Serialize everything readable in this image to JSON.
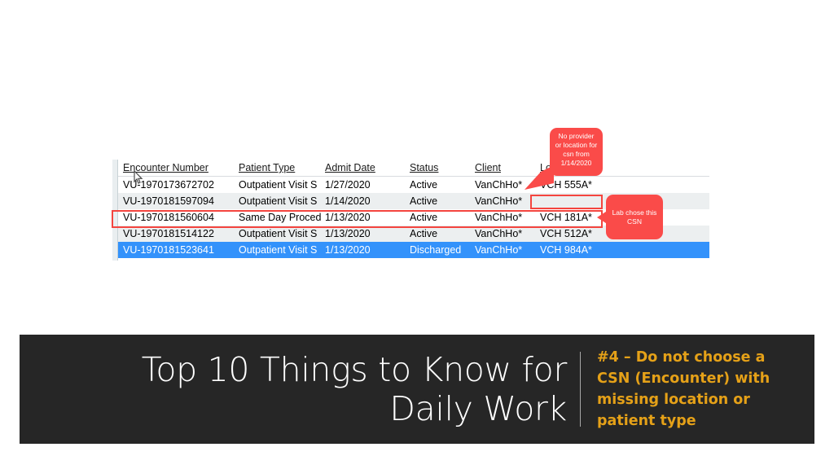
{
  "slide": {
    "background_color": "#ffffff",
    "title_bar": {
      "background_color": "#262626",
      "title": "Top 10 Things to Know for Daily Work",
      "title_color": "#ffffff",
      "subtitle": "#4 – Do not choose a CSN (Encounter) with missing location or patient type",
      "subtitle_color": "#e5a118"
    }
  },
  "screenshot": {
    "app_type": "encounter-grid",
    "colors": {
      "selected_row": "#3392fb",
      "alt_row": "#eceff0",
      "annotation_red": "#f4453f",
      "callout_red": "#fa4b49"
    },
    "table": {
      "columns": [
        {
          "key": "encounter_number",
          "label": "Encounter Number"
        },
        {
          "key": "patient_type",
          "label": "Patient Type"
        },
        {
          "key": "admit_date",
          "label": "Admit Date"
        },
        {
          "key": "status",
          "label": "Status"
        },
        {
          "key": "client",
          "label": "Client"
        },
        {
          "key": "location",
          "label": "Location"
        }
      ],
      "rows": [
        {
          "encounter_number": "VU-1970173672702",
          "patient_type": "Outpatient Visit S",
          "admit_date": "1/27/2020",
          "status": "Active",
          "client": "VanChHo*",
          "location": "VCH 555A*",
          "selected": false,
          "shading": "plain"
        },
        {
          "encounter_number": "VU-1970181597094",
          "patient_type": "Outpatient Visit S",
          "admit_date": "1/14/2020",
          "status": "Active",
          "client": "VanChHo*",
          "location": "",
          "selected": false,
          "shading": "alt"
        },
        {
          "encounter_number": "VU-1970181560604",
          "patient_type": "Same Day Proced",
          "admit_date": "1/13/2020",
          "status": "Active",
          "client": "VanChHo*",
          "location": "VCH 181A*",
          "selected": false,
          "shading": "plain"
        },
        {
          "encounter_number": "VU-1970181514122",
          "patient_type": "Outpatient Visit S",
          "admit_date": "1/13/2020",
          "status": "Active",
          "client": "VanChHo*",
          "location": "VCH 512A*",
          "selected": false,
          "shading": "alt"
        },
        {
          "encounter_number": "VU-1970181523641",
          "patient_type": "Outpatient Visit S",
          "admit_date": "1/13/2020",
          "status": "Discharged",
          "client": "VanChHo*",
          "location": "VCH 984A*",
          "selected": true,
          "shading": "selected"
        }
      ]
    },
    "annotations": {
      "callout_no_provider": "No provider or location for csn from 1/14/2020",
      "callout_lab_chose": "Lab chose this CSN"
    }
  }
}
